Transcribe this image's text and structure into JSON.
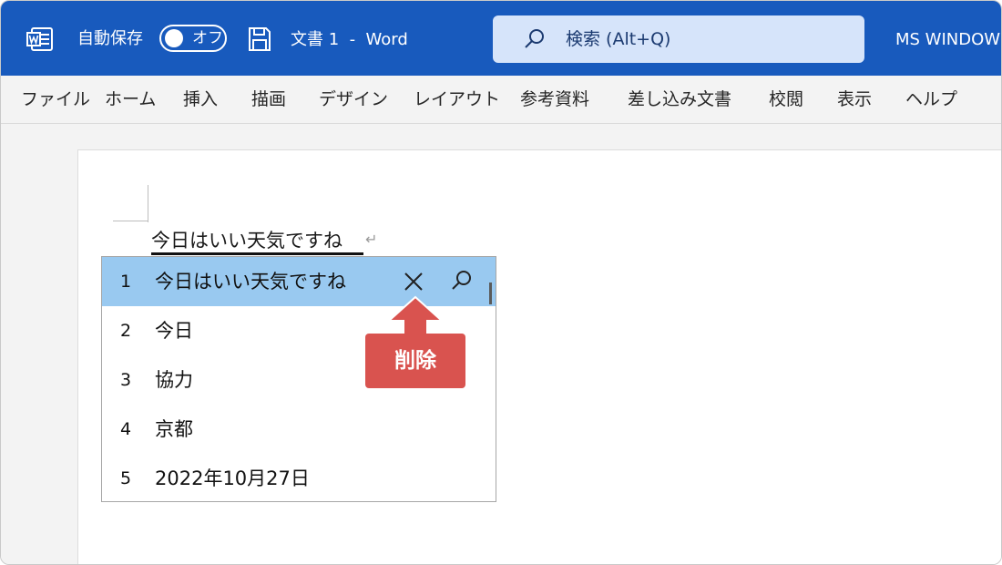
{
  "titlebar": {
    "autosave_label": "自動保存",
    "autosave_state": "オフ",
    "doc_title": "文書 1  -  Word",
    "search_placeholder": "検索 (Alt+Q)",
    "user_name": "MS WINDOWS",
    "background_color": "#185abd"
  },
  "menu": {
    "items": [
      "ファイル",
      "ホーム",
      "挿入",
      "描画",
      "デザイン",
      "レイアウト",
      "参考資料",
      "差し込み文書",
      "校閲",
      "表示",
      "ヘルプ"
    ]
  },
  "document": {
    "typed_text": "今日はいい天気ですね",
    "paragraph_mark": "↵"
  },
  "predictions": {
    "selected_index": 1,
    "items": [
      {
        "num": "1",
        "text": "今日はいい天気ですね"
      },
      {
        "num": "2",
        "text": "今日"
      },
      {
        "num": "3",
        "text": "協力"
      },
      {
        "num": "4",
        "text": "京都"
      },
      {
        "num": "5",
        "text": "2022年10月27日"
      }
    ],
    "selected_color": "#99c9f0"
  },
  "callout": {
    "label": "削除",
    "color": "#d9534f"
  },
  "icons": {
    "app": "word-logo-icon",
    "save": "save-icon",
    "search": "search-icon",
    "delete": "close-icon",
    "row_search": "search-icon"
  }
}
